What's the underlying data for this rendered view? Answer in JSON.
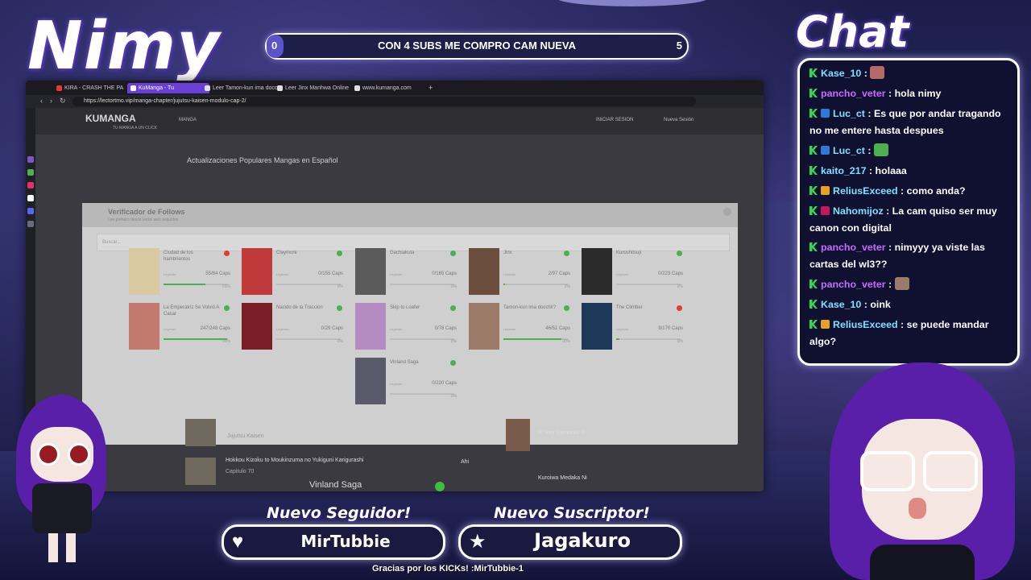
{
  "overlay": {
    "streamer_name": "Nimy",
    "chat_title": "Chat",
    "goal": {
      "text": "CON 4 SUBS ME COMPRO CAM NUEVA",
      "current": "0",
      "target": "5",
      "progress": 0.02
    },
    "new_follower_label": "Nuevo Seguidor!",
    "new_follower_value": "MirTubbie",
    "new_subscriber_label": "Nuevo Suscriptor!",
    "new_subscriber_value": "Jagakuro",
    "footer": "Gracias por los KICKs! :MirTubbie-1"
  },
  "browser": {
    "tabs": [
      {
        "label": "KIRA - CRASH THE PA",
        "color": "#e53935",
        "active": false
      },
      {
        "label": "KuManga - Tu",
        "color": "#7e57c2",
        "active": true
      },
      {
        "label": "Leer Tamon-kun ima docc",
        "color": "#e0e0e0",
        "active": false
      },
      {
        "label": "Leer Jinx Manhwa Online",
        "color": "#e0e0e0",
        "active": false
      },
      {
        "label": "www.kumanga.com",
        "color": "#e0e0e0",
        "active": false
      }
    ],
    "url": "https://lectortmo.vip/manga-chapter/jujutsu-kaisen-modulo-cap-2/",
    "site": {
      "logo": "KUMANGA",
      "tagline": "TU MANGA A UN CLICK",
      "nav_left": "MANGA",
      "nav_right_1": "INICIAR SESION",
      "nav_right_2": "Nueva Sesión",
      "popular_heading": "Actualizaciones Populares Mangas en Español"
    },
    "modal": {
      "title": "Verificador de Follows",
      "subtitle": "Lee primero desde lector web seguidos",
      "search_placeholder": "Buscar...",
      "status_label": "Leyendo",
      "cards": [
        {
          "title": "Ciudad de los hambrientos",
          "caps": "55/84 Caps",
          "pct": "65%",
          "progress": 0.65,
          "status": "#e53935",
          "cover": "#d8c9a0"
        },
        {
          "title": "Claymore",
          "caps": "0/155 Caps",
          "pct": "0%",
          "progress": 0,
          "status": "#4caf50",
          "cover": "#c0393b"
        },
        {
          "title": "Gachiakuta",
          "caps": "0/165 Caps",
          "pct": "0%",
          "progress": 0,
          "status": "#4caf50",
          "cover": "#5b5b5b"
        },
        {
          "title": "Jinx",
          "caps": "2/97 Caps",
          "pct": "2%",
          "progress": 0.02,
          "status": "#4caf50",
          "cover": "#6b4e3d"
        },
        {
          "title": "Kuroshitsuji",
          "caps": "0/223 Caps",
          "pct": "0%",
          "progress": 0,
          "status": "#4caf50",
          "cover": "#2b2b2b"
        },
        {
          "title": "La Emperatriz Se Volvió A Casar",
          "caps": "247/248 Caps",
          "pct": "99%",
          "progress": 0.99,
          "status": "#4caf50",
          "cover": "#c27a6f"
        },
        {
          "title": "Nacido de la Tracción",
          "caps": "0/29 Caps",
          "pct": "0%",
          "progress": 0,
          "status": "#4caf50",
          "cover": "#7a1f2a"
        },
        {
          "title": "Skip to Loafer",
          "caps": "0/78 Caps",
          "pct": "0%",
          "progress": 0,
          "status": "#4caf50",
          "cover": "#b58cc2"
        },
        {
          "title": "Tamon-kun ima docchi!?",
          "caps": "46/51 Caps",
          "pct": "90%",
          "progress": 0.9,
          "status": "#4caf50",
          "cover": "#9c7b6a"
        },
        {
          "title": "The Climber",
          "caps": "9/170 Caps",
          "pct": "0%",
          "progress": 0.05,
          "status": "#e53935",
          "cover": "#1e3a5a"
        },
        {
          "title": "Vinland Saga",
          "caps": "0/220 Caps",
          "pct": "0%",
          "progress": 0,
          "status": "#4caf50",
          "cover": "#5a5a6a"
        }
      ]
    },
    "below": {
      "row1": "Jujutsu Kaisen",
      "row2": "Hokkou Kizoku to Moukinzuma no Yukiguni Karigurashi",
      "row2_sub": "Capitulo 70",
      "row2_badge": "Ahi",
      "right1": "El Rey Demonio III",
      "right2": "Kuroiwa Medaka Ni",
      "vinland": "Vinland Saga"
    }
  },
  "chat": {
    "messages": [
      {
        "user": "Kase_10",
        "color": "#7ee0ff",
        "text": "",
        "badge2": "",
        "emote": "#b56a6a"
      },
      {
        "user": "pancho_veter",
        "color": "#c56bff",
        "text": "hola nimy",
        "badge2": "",
        "emote": ""
      },
      {
        "user": "Luc_ct",
        "color": "#7ee0ff",
        "text": "Es que por andar tragando no me entere hasta despues",
        "badge2": "#2f79d8",
        "emote": ""
      },
      {
        "user": "Luc_ct",
        "color": "#7ee0ff",
        "text": "",
        "badge2": "#2f79d8",
        "emote": "#4caf50"
      },
      {
        "user": "kaito_217",
        "color": "#7ee0ff",
        "text": "holaaa",
        "badge2": "",
        "emote": ""
      },
      {
        "user": "ReliusExceed",
        "color": "#7ee0ff",
        "text": "como anda?",
        "badge2": "#e6a023",
        "emote": ""
      },
      {
        "user": "Nahomijoz",
        "color": "#7ee0ff",
        "text": "La cam quiso ser muy canon con digital",
        "badge2": "#c2185b",
        "emote": ""
      },
      {
        "user": "pancho_veter",
        "color": "#c56bff",
        "text": "nimyyy ya viste las cartas del wl3??",
        "badge2": "",
        "emote": ""
      },
      {
        "user": "pancho_veter",
        "color": "#c56bff",
        "text": "",
        "badge2": "",
        "emote": "#9a7a6a"
      },
      {
        "user": "Kase_10",
        "color": "#7ee0ff",
        "text": "oink",
        "badge2": "",
        "emote": ""
      },
      {
        "user": "ReliusExceed",
        "color": "#7ee0ff",
        "text": "se puede mandar algo?",
        "badge2": "#e6a023",
        "emote": ""
      }
    ]
  }
}
